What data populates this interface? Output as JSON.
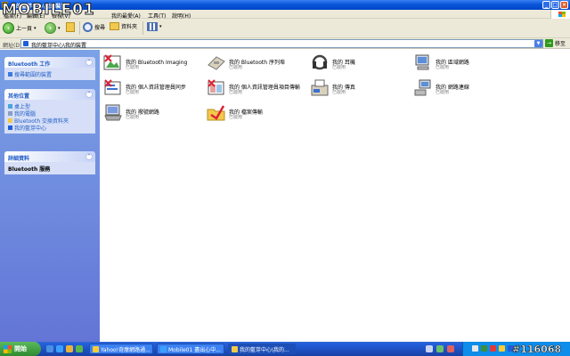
{
  "window": {
    "title": "我的藍芽中心\\我的裝置"
  },
  "watermark": {
    "brand": "MOBILE01",
    "id": "#116068"
  },
  "menu": {
    "items": [
      "檔案(F)",
      "編輯(E)",
      "檢視(V)",
      "我的最愛(A)",
      "工具(T)",
      "說明(H)"
    ]
  },
  "toolbar": {
    "back": "上一頁",
    "search": "搜尋",
    "folders": "資料夾"
  },
  "address": {
    "label": "網址(D)",
    "value": "我的藍芽中心\\我的裝置",
    "go": "移至"
  },
  "tasks_panel": {
    "title": "Bluetooth 工作",
    "items": [
      "搜尋範圍的裝置"
    ]
  },
  "other_panel": {
    "title": "其他位置",
    "items": [
      "桌上型",
      "我的電腦",
      "Bluetooth 交換資料夾",
      "我的藍芽中心"
    ]
  },
  "details_panel": {
    "title": "詳細資料",
    "body": "Bluetooth 服務"
  },
  "services": [
    {
      "name": "我的 Bluetooth Imaging",
      "status": "已啟用"
    },
    {
      "name": "我的 Bluetooth 序列埠",
      "status": "已啟用"
    },
    {
      "name": "我的 耳機",
      "status": "已啟用"
    },
    {
      "name": "我的 區域網路",
      "status": "已啟用"
    },
    {
      "name": "我的 個人資訊管理員同步",
      "status": "已啟用"
    },
    {
      "name": "我的 個人資訊管理員項目傳輸",
      "status": "已啟用"
    },
    {
      "name": "我的 傳真",
      "status": "已啟用"
    },
    {
      "name": "我的 網路連線",
      "status": "已啟用"
    },
    {
      "name": "我的 撥號網路",
      "status": "已啟用"
    },
    {
      "name": "我的 檔案傳輸",
      "status": "已啟用"
    }
  ],
  "taskbar": {
    "start": "開始",
    "tasks": [
      "Yahoo!奇摩網路通...",
      "Mobile01 盡出心中...",
      "我的藍芽中心\\我的..."
    ]
  }
}
